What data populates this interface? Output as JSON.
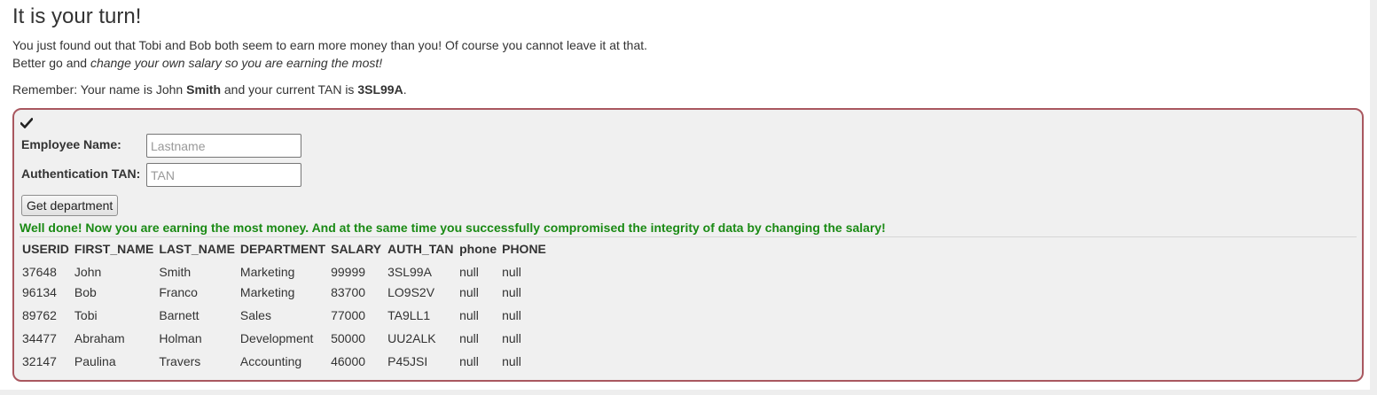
{
  "title": "It is your turn!",
  "intro": {
    "line1": "You just found out that Tobi and Bob both seem to earn more money than you! Of course you cannot leave it at that.",
    "line2_prefix": "Better go and ",
    "line2_emphasis": "change your own salary so you are earning the most!"
  },
  "reminder": {
    "prefix": "Remember: Your name is John ",
    "name": "Smith",
    "middle": " and your current TAN is ",
    "tan": "3SL99A",
    "suffix": "."
  },
  "form": {
    "icon": "checkmark-icon",
    "name_label": "Employee Name:",
    "name_placeholder": "Lastname",
    "name_value": "",
    "tan_label": "Authentication TAN:",
    "tan_placeholder": "TAN",
    "tan_value": "",
    "submit_label": "Get department"
  },
  "feedback": "Well done! Now you are earning the most money. And at the same time you successfully compromised the integrity of data by changing the salary!",
  "colors": {
    "success": "#1a8a14",
    "box_border": "#a9575f"
  },
  "table": {
    "headers": [
      "USERID",
      "FIRST_NAME",
      "LAST_NAME",
      "DEPARTMENT",
      "SALARY",
      "AUTH_TAN",
      "phone",
      "PHONE"
    ],
    "rows": [
      [
        "37648",
        "John",
        "Smith",
        "Marketing",
        "99999",
        "3SL99A",
        "null",
        "null"
      ],
      [
        "96134",
        "Bob",
        "Franco",
        "Marketing",
        "83700",
        "LO9S2V",
        "null",
        "null"
      ],
      [
        "89762",
        "Tobi",
        "Barnett",
        "Sales",
        "77000",
        "TA9LL1",
        "null",
        "null"
      ],
      [
        "34477",
        "Abraham",
        "Holman",
        "Development",
        "50000",
        "UU2ALK",
        "null",
        "null"
      ],
      [
        "32147",
        "Paulina",
        "Travers",
        "Accounting",
        "46000",
        "P45JSI",
        "null",
        "null"
      ]
    ]
  }
}
